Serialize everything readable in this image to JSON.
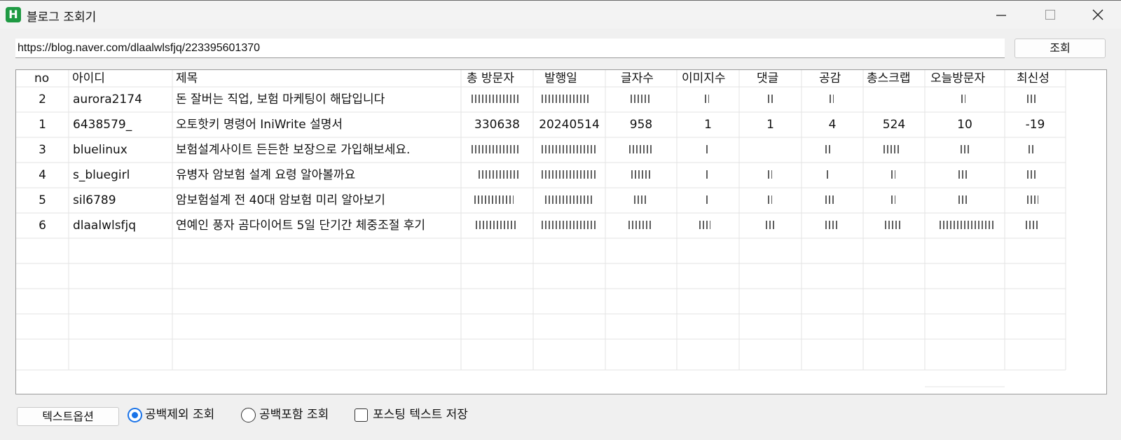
{
  "window": {
    "title": "블로그 조회기",
    "icon_letter": "H",
    "accent_color": "#1a73e8",
    "icon_color": "#1f9a43"
  },
  "toolbar": {
    "url_value": "https://blog.naver.com/dlaalwlsfjq/223395601370",
    "search_label": "조회"
  },
  "table": {
    "columns": [
      "no",
      "아이디",
      "제목",
      "총 방문자",
      "발행일",
      "글자수",
      "이미지수",
      "댓글",
      "공감",
      "총스크랩",
      "오늘방문자",
      "최신성"
    ],
    "rows": [
      {
        "no": "2",
        "id": "aurora2174",
        "title": "돈 잘버는 직업, 보험 마케팅이 해답입니다",
        "visitors": "",
        "published": "",
        "chars": "",
        "images": "",
        "comments": "",
        "likes": "",
        "scraps": "",
        "today": "",
        "freshness": ""
      },
      {
        "no": "1",
        "id": "6438579_",
        "title": "오토핫키 명령어 IniWrite 설명서",
        "visitors": "330638",
        "published": "20240514",
        "chars": "958",
        "images": "1",
        "comments": "1",
        "likes": "4",
        "scraps": "524",
        "today": "10",
        "freshness": "-19"
      },
      {
        "no": "3",
        "id": "bluelinux",
        "title": "보험설계사이트 든든한 보장으로 가입해보세요.",
        "visitors": "",
        "published": "",
        "chars": "",
        "images": "",
        "comments": "",
        "likes": "",
        "scraps": "",
        "today": "",
        "freshness": ""
      },
      {
        "no": "4",
        "id": "s_bluegirl",
        "title": "유병자 암보험 설계 요령 알아볼까요",
        "visitors": "",
        "published": "",
        "chars": "",
        "images": "",
        "comments": "",
        "likes": "",
        "scraps": "",
        "today": "",
        "freshness": ""
      },
      {
        "no": "5",
        "id": "sil6789",
        "title": "암보험설계 전 40대 암보험 미리 알아보기",
        "visitors": "",
        "published": "",
        "chars": "",
        "images": "",
        "comments": "",
        "likes": "",
        "scraps": "",
        "today": "",
        "freshness": ""
      },
      {
        "no": "6",
        "id": "dlaalwlsfjq",
        "title": "연예인 풍자 곰다이어트 5일 단기간 체중조절 후기",
        "visitors": "",
        "published": "",
        "chars": "",
        "images": "",
        "comments": "",
        "likes": "",
        "scraps": "",
        "today": "",
        "freshness": ""
      }
    ]
  },
  "bottom": {
    "text_options_label": "텍스트옵션",
    "radio_exclude_label": "공백제외 조회",
    "radio_include_label": "공백포함 조회",
    "radio_selected": "exclude",
    "checkbox_label": "포스팅 텍스트 저장",
    "checkbox_checked": false
  }
}
